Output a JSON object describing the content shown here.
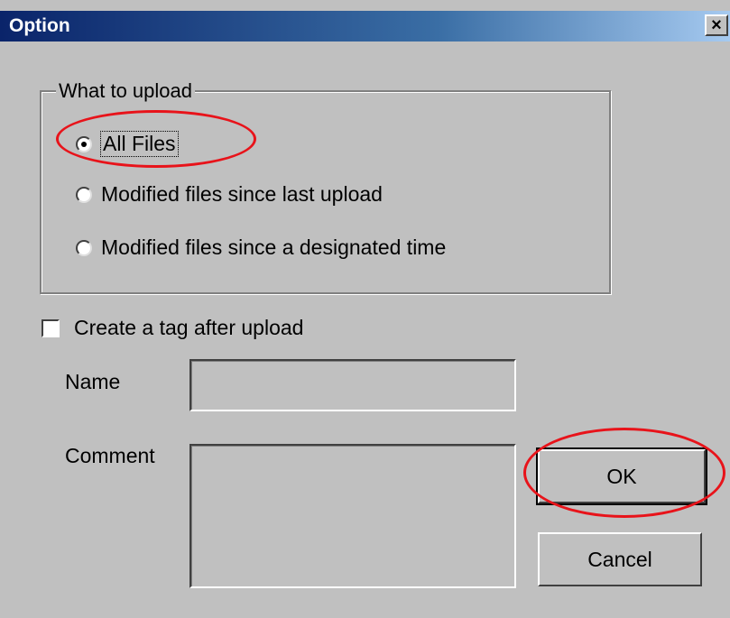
{
  "window": {
    "title": "Option",
    "close_label": "×"
  },
  "upload_group": {
    "legend": "What to upload",
    "options": [
      {
        "label": "All Files",
        "checked": true
      },
      {
        "label": "Modified files since last upload",
        "checked": false
      },
      {
        "label": "Modified files since a designated time",
        "checked": false
      }
    ]
  },
  "tag": {
    "checkbox_label": "Create a tag after upload",
    "checked": false,
    "name_label": "Name",
    "name_value": "",
    "comment_label": "Comment",
    "comment_value": ""
  },
  "buttons": {
    "ok": "OK",
    "cancel": "Cancel"
  },
  "colors": {
    "dialog_bg": "#c0c0c0",
    "title_bar_start": "#0a246a",
    "title_bar_end": "#a6caf0",
    "annotation": "#e8131a"
  }
}
